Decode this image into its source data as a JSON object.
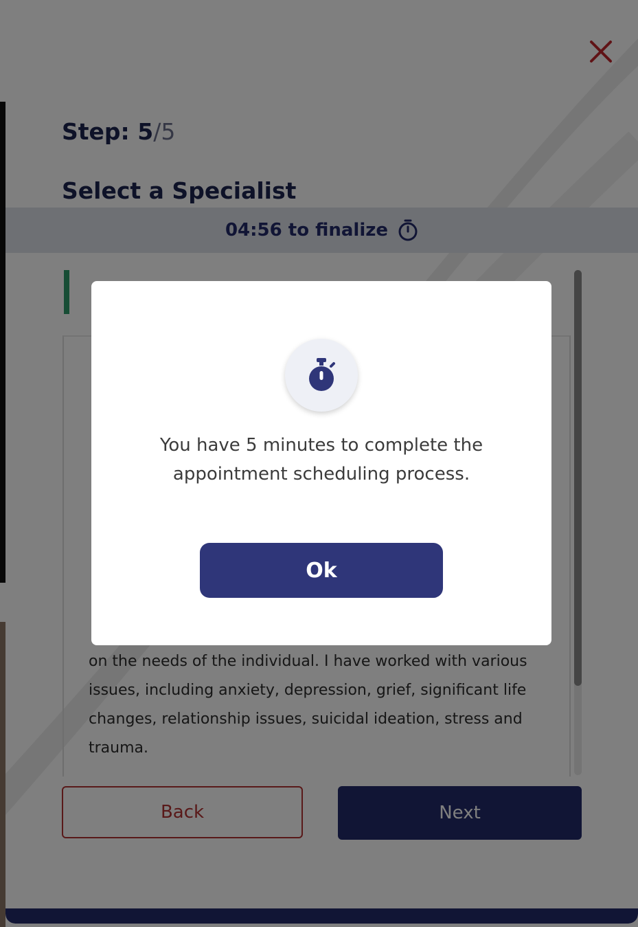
{
  "step": {
    "prefix": "Step: ",
    "current": "5",
    "total": "/5"
  },
  "page_title": "Select a Specialist",
  "timer": {
    "text": "04:56 to finalize",
    "icon": "stopwatch-icon"
  },
  "bio_text": "on the needs of the individual. I have worked with various issues, including anxiety, depression, grief, significant life changes, relationship issues, suicidal ideation, stress and trauma.",
  "buttons": {
    "back": "Back",
    "next": "Next"
  },
  "modal": {
    "icon": "stopwatch-icon",
    "message": "You have 5 minutes to complete the appointment scheduling process.",
    "ok": "Ok"
  },
  "colors": {
    "primary": "#232a6a",
    "close": "#c0262d",
    "back_border": "#b23232",
    "accent_green": "#2e9a6a"
  }
}
